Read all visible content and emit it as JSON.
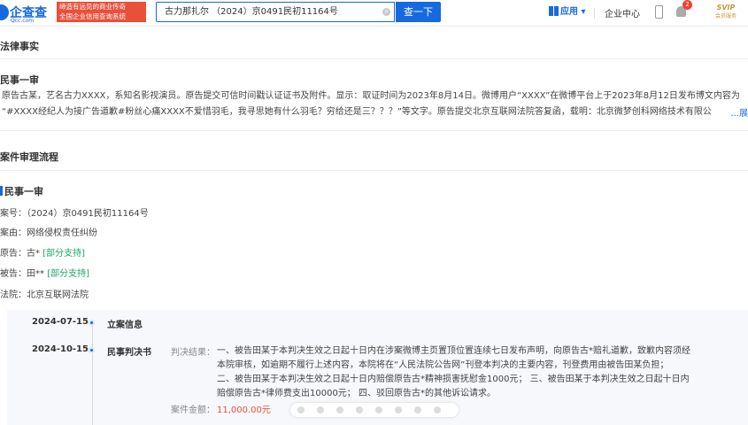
{
  "header": {
    "logo_text": "企查查",
    "logo_sub": "Qcc.com",
    "slogan_line1": "缔造有远见的商业传奇",
    "slogan_line2": "全国企业信用查询系统",
    "search_value": "古力那扎尔 （2024）京0491民初11164号",
    "search_button": "查一下",
    "app_menu": "应用",
    "enterprise_center": "企业中心",
    "notification_count": "2",
    "svip_label": "SVIP",
    "svip_sub": "会员服务"
  },
  "legal_facts": {
    "title": "法律事实",
    "subtitle": "民事一审",
    "line1": "原告古某，艺名古力XXXX，系知名影视演员。原告提交可信时间戳认证证书及附件。显示：取证时间为2023年8月14日。微博用户“XXXX”在微博平台上于2023年8月12日发布博文内容为",
    "line2": "“#XXXX经纪人为接广告道歉#粉丝心痛XXXX不爱惜羽毛，我寻思她有什么羽毛？穷给还是三？？？”等文字。原告提交北京互联网法院答复函，载明：北京微梦创科网络技术有限公",
    "more": "...展"
  },
  "trial_process": {
    "title": "案件审理流程",
    "case_title": "民事一审",
    "case_no": "案号：（2024）京0491民初11164号",
    "cause": "案由：网络侵权责任纠纷",
    "plaintiff_label": "原告：古*",
    "plaintiff_tag": "[部分支持]",
    "defendant_label": "被告：田**",
    "defendant_tag": "[部分支持]",
    "court": "法院：北京互联网法院"
  },
  "timeline": [
    {
      "date": "2024-07-15",
      "label": "立案信息"
    },
    {
      "date": "2024-10-15",
      "label": "民事判决书"
    }
  ],
  "judgment": {
    "label": "判决结果：",
    "line1": "一、被告田某于本判决生效之日起十日内在涉案微博主页置顶位置连续七日发布声明，向原告古*赔礼道歉，致歉内容须经",
    "line2": "本院审核，如逾期不履行上述内容，本院将在“人民法院公告网”刊登本判决的主要内容，刊登费用由被告田某负担；",
    "line3": "二、被告田某于本判决生效之日起十日内赔偿原告古*精神损害抚慰金1000元； 三、被告田某于本判决生效之日起十日内",
    "line4": "赔偿原告古*律师费支出10000元； 四、驳回原告古*的其他诉讼请求。",
    "amount_label": "案件金额：",
    "amount_value": "11,000.00元"
  },
  "colors": {
    "brand": "#1769e0",
    "tag_green": "#1ba765",
    "amount_red": "#e8503a"
  }
}
